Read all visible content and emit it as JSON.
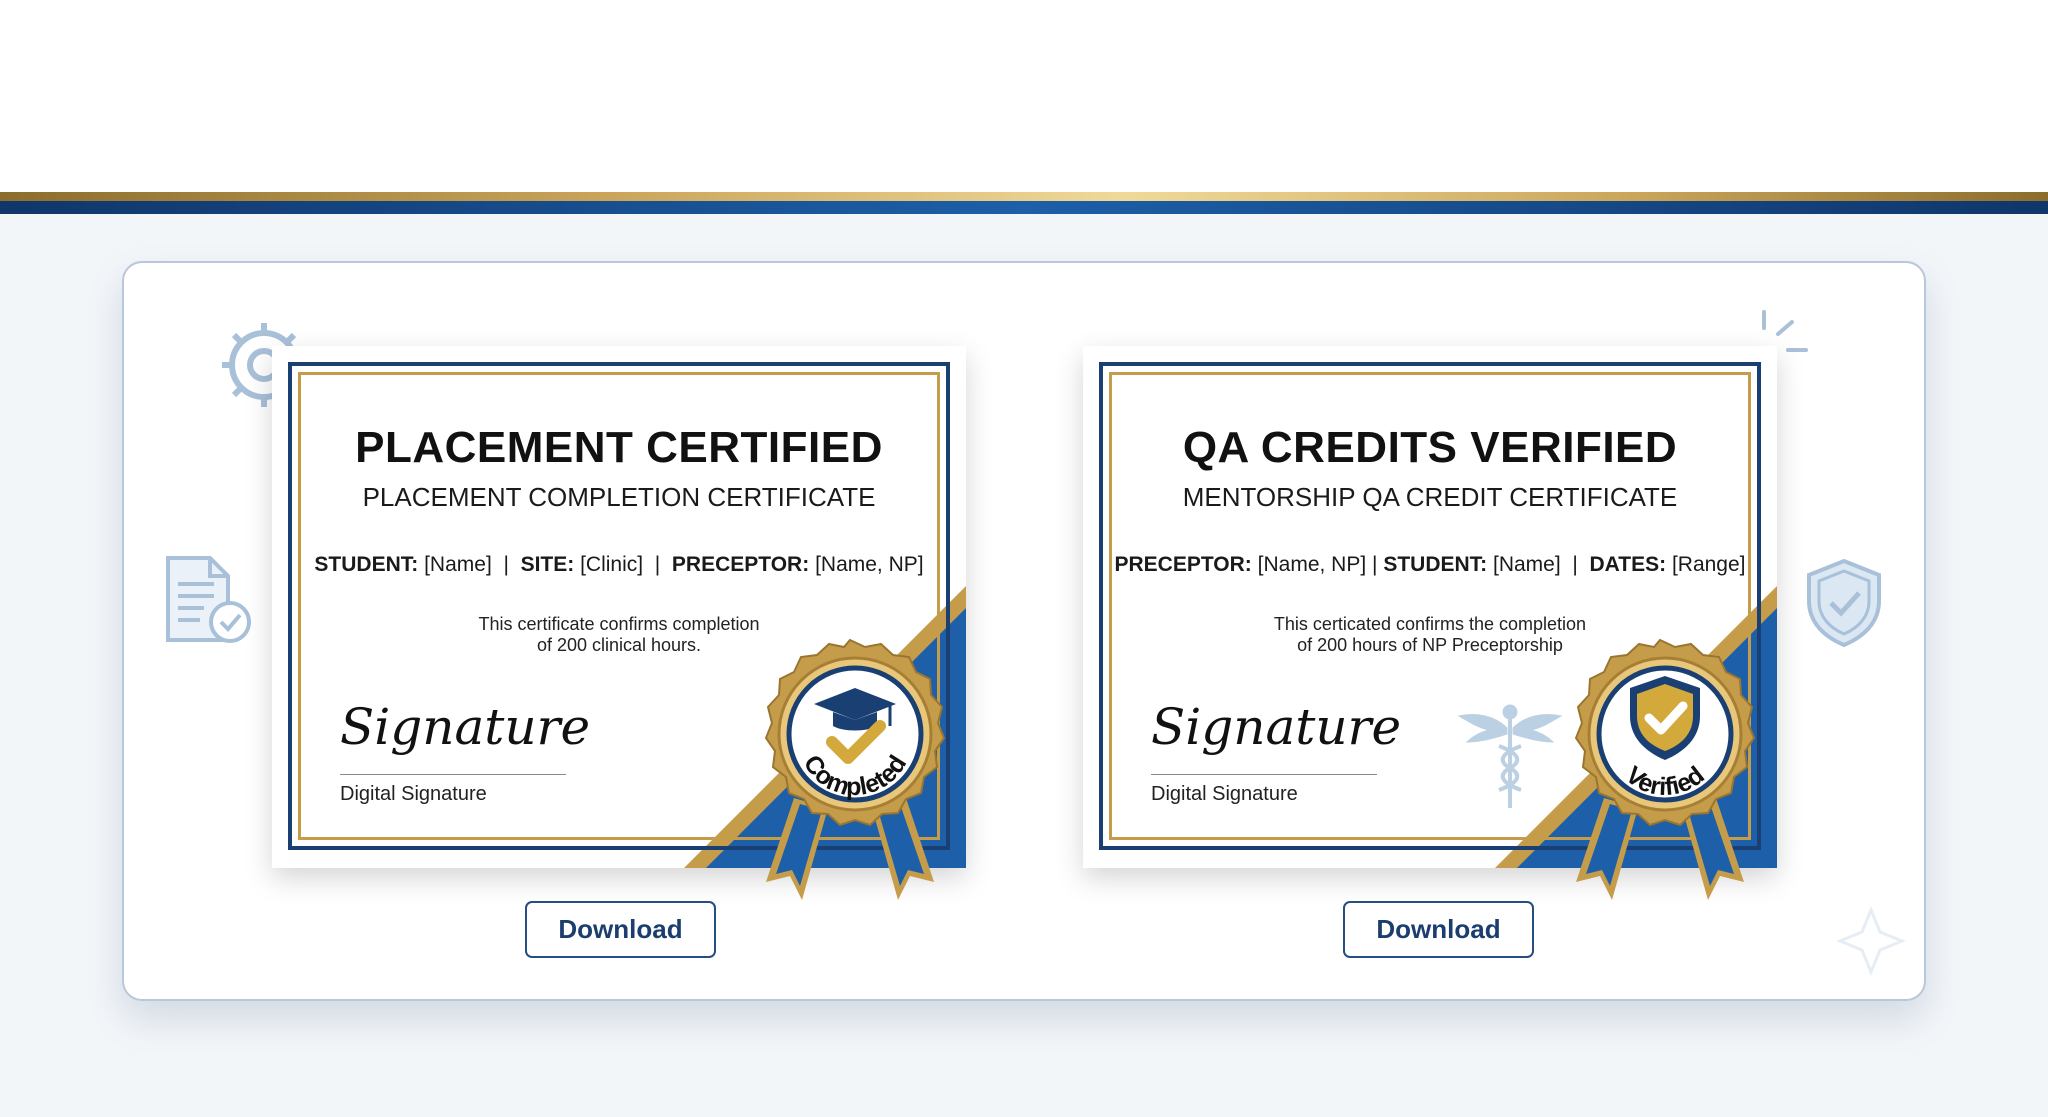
{
  "certificates": [
    {
      "title": "PLACEMENT CERTIFIED",
      "subtitle": "PLACEMENT COMPLETION CERTIFICATE",
      "fields": [
        {
          "label": "STUDENT:",
          "value": "[Name]"
        },
        {
          "label": "SITE:",
          "value": "[Clinic]"
        },
        {
          "label": "PRECEPTOR:",
          "value": "[Name, NP]"
        }
      ],
      "body_line1": "This certificate  confirms completion",
      "body_line2": "of 200 clinical hours.",
      "signature_script": "Signature",
      "signature_label": "Digital Signature",
      "seal_text": "Completed",
      "seal_icon": "graduation-cap-icon",
      "download_label": "Download"
    },
    {
      "title": "QA CREDITS VERIFIED",
      "subtitle": "MENTORSHIP QA CREDIT CERTIFICATE",
      "fields": [
        {
          "label": "PRECEPTOR:",
          "value": "[Name, NP]"
        },
        {
          "label": "STUDENT:",
          "value": "[Name]"
        },
        {
          "label": "DATES:",
          "value": "[Range]"
        }
      ],
      "body_line1": "This certicated confirms the completion",
      "body_line2": "of 200 hours of NP Preceptorship",
      "signature_script": "Signature",
      "signature_label": "Digital Signature",
      "seal_text": "Verified",
      "seal_icon": "shield-check-icon",
      "download_label": "Download"
    }
  ],
  "decorations": [
    "gear-icon",
    "document-check-icon",
    "shield-check-icon",
    "sparkle-icon",
    "caduceus-icon"
  ],
  "colors": {
    "navy": "#1a3f73",
    "gold": "#c59d4a",
    "ribbon_blue": "#1d5fa8"
  }
}
